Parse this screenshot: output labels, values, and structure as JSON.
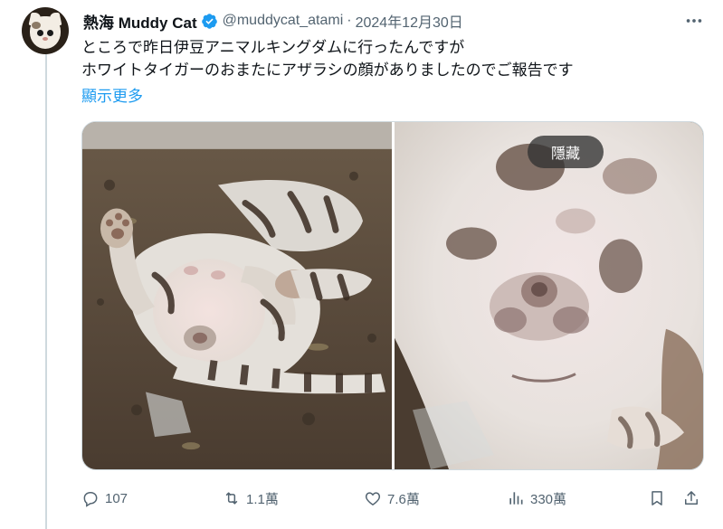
{
  "tweet": {
    "display_name": "熱海 Muddy Cat",
    "handle": "@muddycat_atami",
    "separator": "·",
    "date": "2024年12月30日",
    "text_line1": "ところで昨日伊豆アニマルキングダムに行ったんですが",
    "text_line2": "ホワイトタイガーのおまたにアザラシの顔がありましたのでご報告です",
    "show_more": "顯示更多",
    "hide_label": "隱藏"
  },
  "stats": {
    "replies": "107",
    "retweets": "1.1萬",
    "likes": "7.6萬",
    "views": "330萬"
  },
  "icons": {
    "verified": "verified-badge-icon",
    "more": "more-dots-icon",
    "reply": "reply-bubble-icon",
    "retweet": "retweet-icon",
    "like": "heart-icon",
    "views": "bar-chart-icon",
    "bookmark": "bookmark-icon",
    "share": "share-icon"
  },
  "colors": {
    "text": "#0f1419",
    "secondary": "#536471",
    "link": "#1d9bf0",
    "verified": "#1d9bf0",
    "border": "#cfd9de"
  }
}
